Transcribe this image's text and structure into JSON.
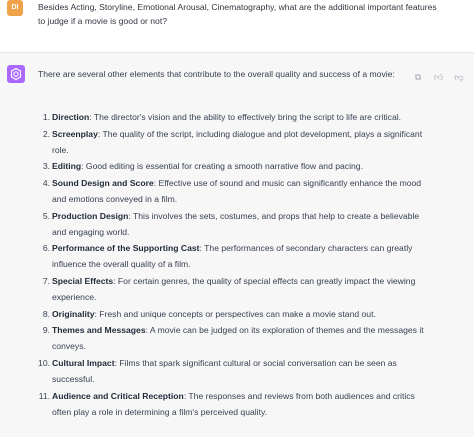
{
  "user": {
    "avatar": "DI",
    "question": "Besides Acting, Storyline, Emotional Arousal, Cinematography, what are the additional important features to judge if a movie is good or not?"
  },
  "assistant": {
    "intro": "There are several other elements that contribute to the overall quality and success of a movie:",
    "items": [
      {
        "num": "1.",
        "title": "Direction",
        "text": ": The director's vision and the ability to effectively bring the script to life are critical."
      },
      {
        "num": "2.",
        "title": "Screenplay",
        "text": ": The quality of the script, including dialogue and plot development, plays a significant role."
      },
      {
        "num": "3.",
        "title": "Editing",
        "text": ": Good editing is essential for creating a smooth narrative flow and pacing."
      },
      {
        "num": "4.",
        "title": "Sound Design and Score",
        "text": ": Effective use of sound and music can significantly enhance the mood and emotions conveyed in a film."
      },
      {
        "num": "5.",
        "title": "Production Design",
        "text": ": This involves the sets, costumes, and props that help to create a believable and engaging world."
      },
      {
        "num": "6.",
        "title": "Performance of the Supporting Cast",
        "text": ": The performances of secondary characters can greatly influence the overall quality of a film."
      },
      {
        "num": "7.",
        "title": "Special Effects",
        "text": ": For certain genres, the quality of special effects can greatly impact the viewing experience."
      },
      {
        "num": "8.",
        "title": "Originality",
        "text": ": Fresh and unique concepts or perspectives can make a movie stand out."
      },
      {
        "num": "9.",
        "title": "Themes and Messages",
        "text": ": A movie can be judged on its exploration of themes and the messages it conveys."
      },
      {
        "num": "10.",
        "title": "Cultural Impact",
        "text": ": Films that spark significant cultural or social conversation can be seen as successful."
      },
      {
        "num": "11.",
        "title": "Audience and Critical Reception",
        "text": ": The responses and reviews from both audiences and critics often play a role in determining a film's perceived quality."
      }
    ]
  },
  "actions": {
    "copy_icon": "copy-icon",
    "thumbs_up_icon": "thumbs-up-icon",
    "thumbs_down_icon": "thumbs-down-icon"
  },
  "colors": {
    "user_avatar_bg": "#f0a24b",
    "gpt_avatar_bg": "#ab68ff",
    "assistant_bg": "#f7f7f8"
  }
}
